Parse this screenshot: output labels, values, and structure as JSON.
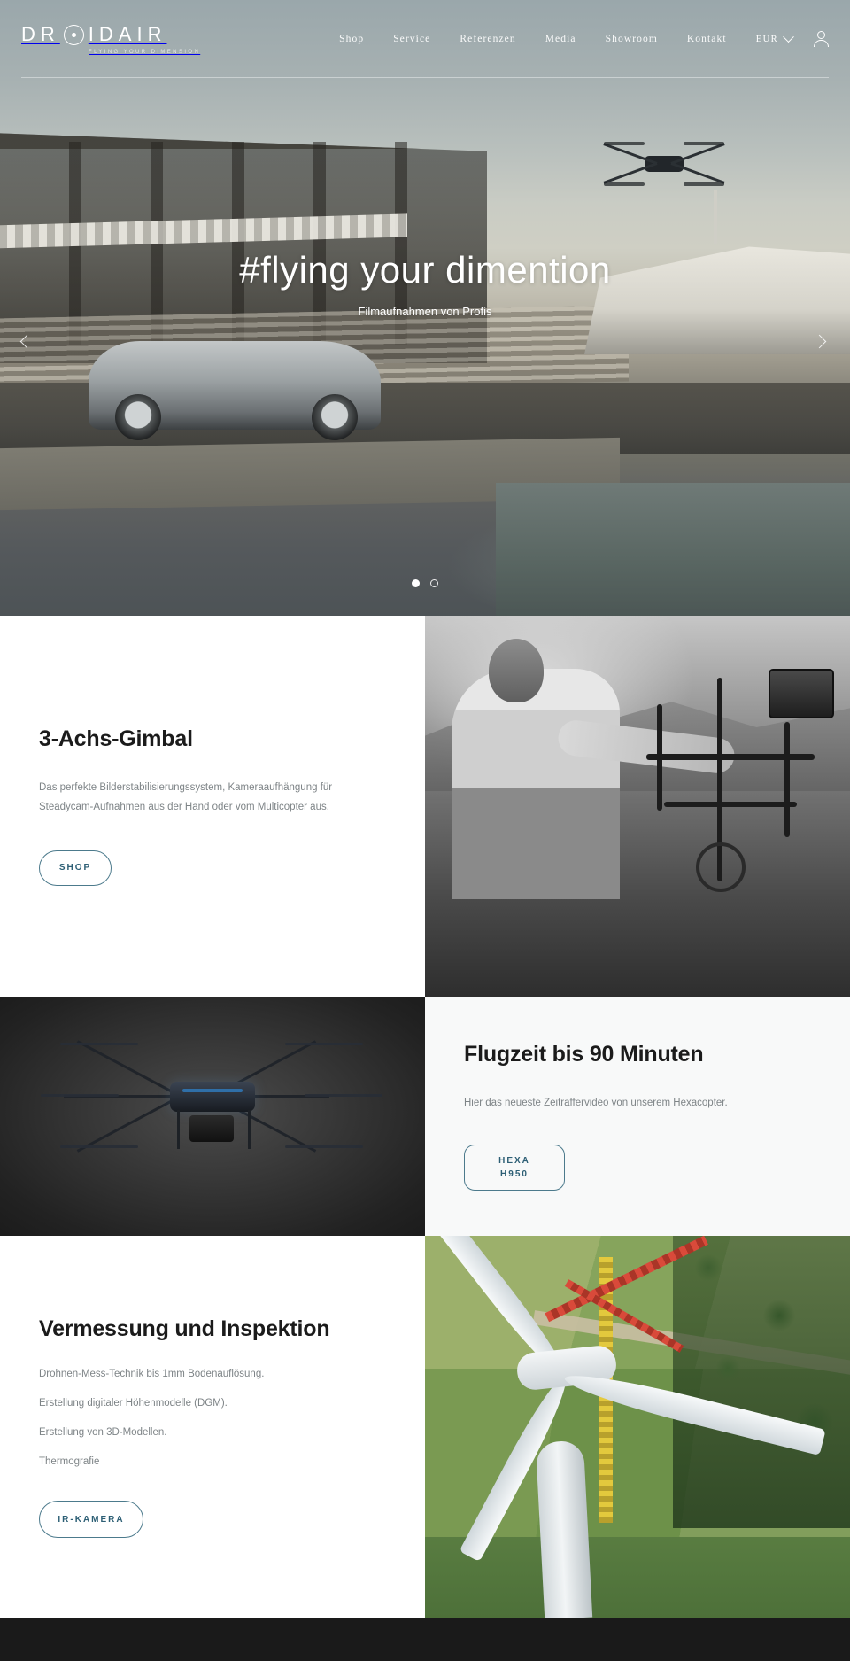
{
  "header": {
    "logo": {
      "word_left": "DR",
      "word_right": "IDAIR",
      "tagline": "FLYING YOUR DIMENSION"
    },
    "nav": [
      {
        "label": "Shop"
      },
      {
        "label": "Service"
      },
      {
        "label": "Referenzen"
      },
      {
        "label": "Media"
      },
      {
        "label": "Showroom"
      },
      {
        "label": "Kontakt"
      }
    ],
    "currency": {
      "value": "EUR",
      "icon": "chevron-down-icon"
    },
    "account_icon": "user-icon"
  },
  "hero": {
    "title": "#flying your dimention",
    "subtitle": "Filmaufnahmen von Profis",
    "prev_icon": "chevron-left-icon",
    "next_icon": "chevron-right-icon",
    "slides": 2,
    "active_slide": 1
  },
  "sections": [
    {
      "title": "3-Achs-Gimbal",
      "body": "Das perfekte Bilderstabilisierungssystem, Kameraaufhängung für Steadycam-Aufnahmen aus der Hand oder vom Multicopter aus.",
      "button": "SHOP"
    },
    {
      "title": "Flugzeit bis 90 Minuten",
      "body": "Hier das neueste Zeitraffervideo von unserem Hexacopter.",
      "button_line1": "HEXA",
      "button_line2": "H950"
    },
    {
      "title": "Vermessung und Inspektion",
      "items": [
        "Drohnen-Mess-Technik bis 1mm Bodenauflösung.",
        "Erstellung digitaler Höhenmodelle (DGM).",
        "Erstellung von 3D-Modellen.",
        "Thermografie"
      ],
      "button": "IR-KAMERA"
    }
  ],
  "colors": {
    "accent": "#4c7a8c",
    "accent_text": "#2d5f75",
    "heading": "#1b1b1b",
    "body_text": "#7e8487",
    "footer_bg": "#1a1a1a",
    "panel_light": "#f8f9f9"
  }
}
